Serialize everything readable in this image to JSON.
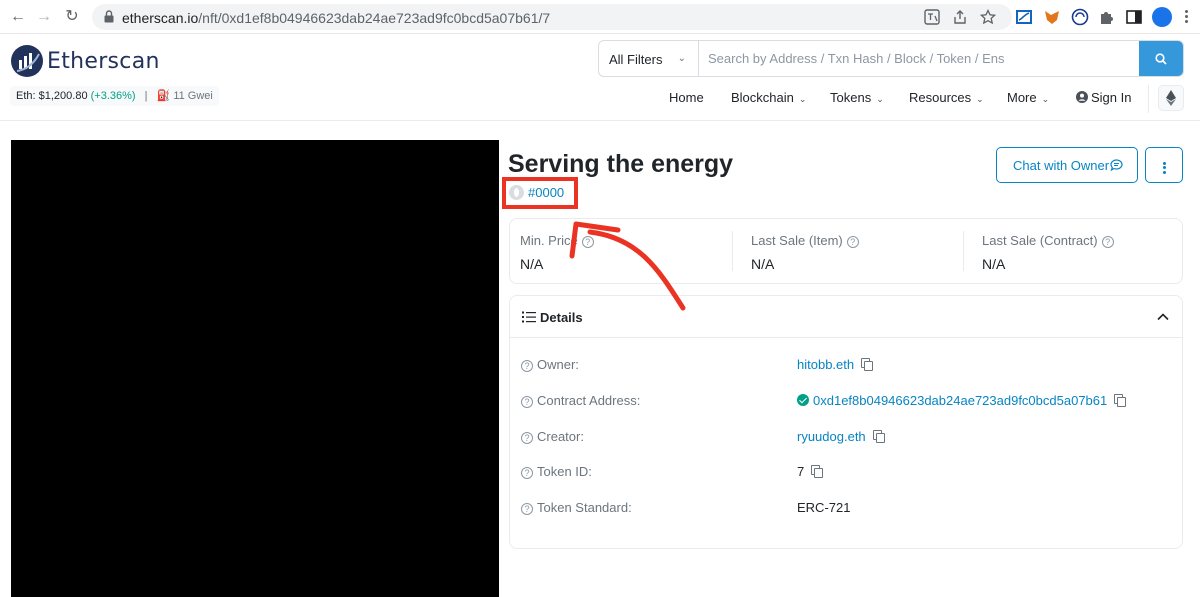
{
  "browser": {
    "url_host": "etherscan.io",
    "url_path": "/nft/0xd1ef8b04946623dab24ae723ad9fc0bcd5a07b61/7"
  },
  "header": {
    "logo_text": "Etherscan",
    "eth_price_label": "Eth: $1,200.80",
    "eth_change": "(+3.36%)",
    "gas": "11 Gwei",
    "filter_label": "All Filters",
    "search_placeholder": "Search by Address / Txn Hash / Block / Token / Ens"
  },
  "nav": {
    "home": "Home",
    "blockchain": "Blockchain",
    "tokens": "Tokens",
    "resources": "Resources",
    "more": "More",
    "sign_in": "Sign In"
  },
  "nft": {
    "title": "Serving the energy",
    "token_tag": "#0000",
    "chat_label": "Chat with Owner"
  },
  "prices": [
    {
      "label": "Min. Price",
      "value": "N/A"
    },
    {
      "label": "Last Sale (Item)",
      "value": "N/A"
    },
    {
      "label": "Last Sale (Contract)",
      "value": "N/A"
    }
  ],
  "details": {
    "title": "Details",
    "rows": [
      {
        "label": "Owner:",
        "value": "hitobb.eth"
      },
      {
        "label": "Contract Address:",
        "value": "0xd1ef8b04946623dab24ae723ad9fc0bcd5a07b61"
      },
      {
        "label": "Creator:",
        "value": "ryuudog.eth"
      },
      {
        "label": "Token ID:",
        "value": "7"
      },
      {
        "label": "Token Standard:",
        "value": "ERC-721"
      }
    ]
  },
  "colors": {
    "brand": "#21325b",
    "link": "#0784c3",
    "search_button": "#3498db",
    "positive": "#00a186",
    "annotation": "#ea3323"
  }
}
